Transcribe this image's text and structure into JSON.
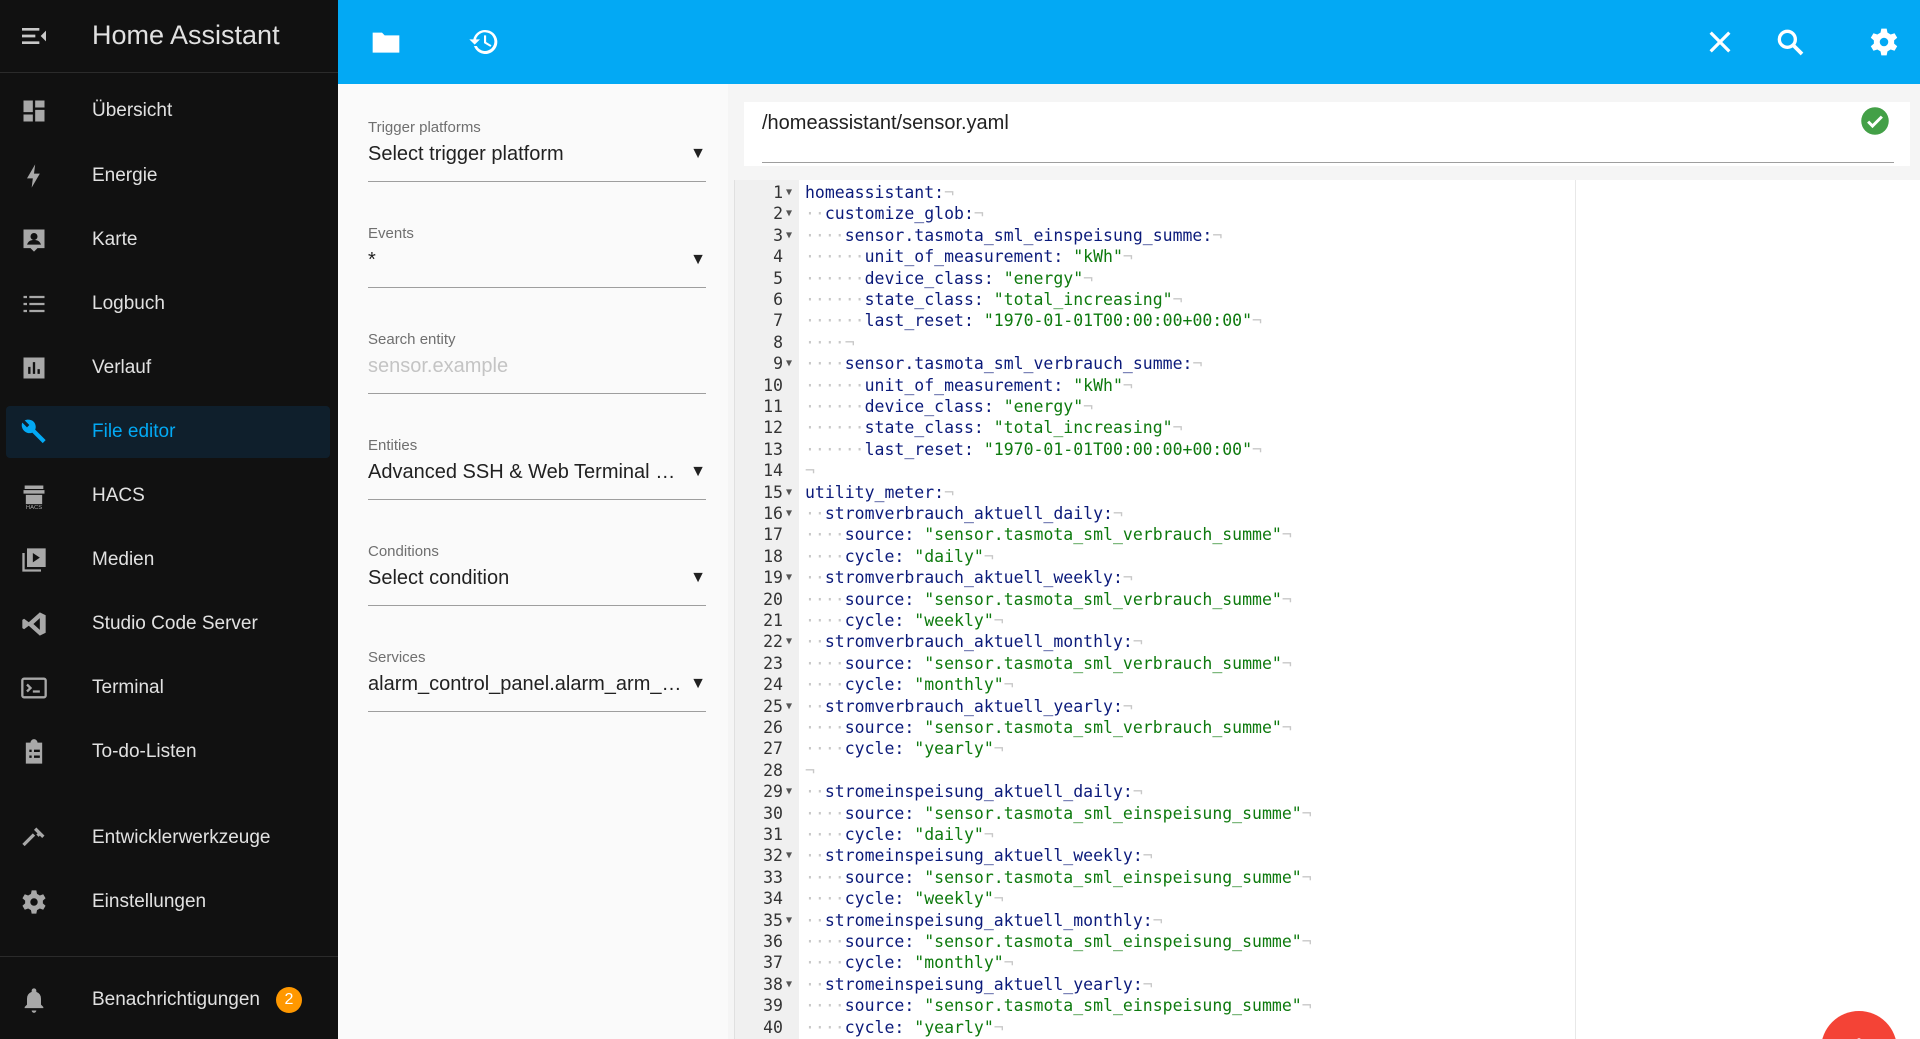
{
  "sidebar": {
    "title": "Home Assistant",
    "items": [
      {
        "id": "overview",
        "label": "Übersicht",
        "icon": "dashboard-icon"
      },
      {
        "id": "energy",
        "label": "Energie",
        "icon": "lightning-bolt-icon"
      },
      {
        "id": "map",
        "label": "Karte",
        "icon": "map-account-icon"
      },
      {
        "id": "logbook",
        "label": "Logbuch",
        "icon": "list-icon"
      },
      {
        "id": "history",
        "label": "Verlauf",
        "icon": "chart-box-icon"
      },
      {
        "id": "file-editor",
        "label": "File editor",
        "icon": "wrench-icon",
        "active": true
      },
      {
        "id": "hacs",
        "label": "HACS",
        "icon": "hacs-icon"
      },
      {
        "id": "media",
        "label": "Medien",
        "icon": "play-box-icon"
      },
      {
        "id": "studio-code-server",
        "label": "Studio Code Server",
        "icon": "vscode-icon"
      },
      {
        "id": "terminal",
        "label": "Terminal",
        "icon": "terminal-icon"
      },
      {
        "id": "todo",
        "label": "To-do-Listen",
        "icon": "clipboard-list-icon"
      },
      {
        "id": "developer-tools",
        "label": "Entwicklerwerkzeuge",
        "icon": "hammer-icon"
      },
      {
        "id": "settings",
        "label": "Einstellungen",
        "icon": "gear-icon"
      }
    ],
    "notifications": {
      "label": "Benachrichtigungen",
      "count": "2",
      "icon": "bell-icon"
    }
  },
  "topbar": {
    "icons": [
      "folder-icon",
      "history-icon",
      "close-icon",
      "search-icon",
      "gear-icon"
    ]
  },
  "form": {
    "trigger_platforms": {
      "label": "Trigger platforms",
      "value": "Select trigger platform"
    },
    "events": {
      "label": "Events",
      "value": "*"
    },
    "search_entity": {
      "label": "Search entity",
      "placeholder": "sensor.example"
    },
    "entities": {
      "label": "Entities",
      "value": "Advanced SSH & Web Terminal Up..."
    },
    "conditions": {
      "label": "Conditions",
      "value": "Select condition"
    },
    "services": {
      "label": "Services",
      "value": "alarm_control_panel.alarm_arm_a..."
    }
  },
  "editor": {
    "file_path": "/homeassistant/sensor.yaml",
    "status_icon": "check-circle-icon",
    "status_color": "#43a047",
    "lines": [
      {
        "n": "1",
        "fold": true,
        "indent": 0,
        "key": "homeassistant:",
        "val": ""
      },
      {
        "n": "2",
        "fold": true,
        "indent": 1,
        "key": "customize_glob:",
        "val": ""
      },
      {
        "n": "3",
        "fold": true,
        "indent": 2,
        "key": "sensor.tasmota_sml_einspeisung_summe:",
        "val": ""
      },
      {
        "n": "4",
        "fold": false,
        "indent": 3,
        "key": "unit_of_measurement: ",
        "val": "\"kWh\""
      },
      {
        "n": "5",
        "fold": false,
        "indent": 3,
        "key": "device_class: ",
        "val": "\"energy\""
      },
      {
        "n": "6",
        "fold": false,
        "indent": 3,
        "key": "state_class: ",
        "val": "\"total_increasing\""
      },
      {
        "n": "7",
        "fold": false,
        "indent": 3,
        "key": "last_reset: ",
        "val": "\"1970-01-01T00:00:00+00:00\""
      },
      {
        "n": "8",
        "fold": false,
        "indent": 2,
        "key": "",
        "val": ""
      },
      {
        "n": "9",
        "fold": true,
        "indent": 2,
        "key": "sensor.tasmota_sml_verbrauch_summe:",
        "val": ""
      },
      {
        "n": "10",
        "fold": false,
        "indent": 3,
        "key": "unit_of_measurement: ",
        "val": "\"kWh\""
      },
      {
        "n": "11",
        "fold": false,
        "indent": 3,
        "key": "device_class: ",
        "val": "\"energy\""
      },
      {
        "n": "12",
        "fold": false,
        "indent": 3,
        "key": "state_class: ",
        "val": "\"total_increasing\""
      },
      {
        "n": "13",
        "fold": false,
        "indent": 3,
        "key": "last_reset: ",
        "val": "\"1970-01-01T00:00:00+00:00\""
      },
      {
        "n": "14",
        "fold": false,
        "indent": 0,
        "key": "",
        "val": ""
      },
      {
        "n": "15",
        "fold": true,
        "indent": 0,
        "key": "utility_meter:",
        "val": ""
      },
      {
        "n": "16",
        "fold": true,
        "indent": 1,
        "key": "stromverbrauch_aktuell_daily:",
        "val": ""
      },
      {
        "n": "17",
        "fold": false,
        "indent": 2,
        "key": "source: ",
        "val": "\"sensor.tasmota_sml_verbrauch_summe\""
      },
      {
        "n": "18",
        "fold": false,
        "indent": 2,
        "key": "cycle: ",
        "val": "\"daily\""
      },
      {
        "n": "19",
        "fold": true,
        "indent": 1,
        "key": "stromverbrauch_aktuell_weekly:",
        "val": ""
      },
      {
        "n": "20",
        "fold": false,
        "indent": 2,
        "key": "source: ",
        "val": "\"sensor.tasmota_sml_verbrauch_summe\""
      },
      {
        "n": "21",
        "fold": false,
        "indent": 2,
        "key": "cycle: ",
        "val": "\"weekly\""
      },
      {
        "n": "22",
        "fold": true,
        "indent": 1,
        "key": "stromverbrauch_aktuell_monthly:",
        "val": ""
      },
      {
        "n": "23",
        "fold": false,
        "indent": 2,
        "key": "source: ",
        "val": "\"sensor.tasmota_sml_verbrauch_summe\""
      },
      {
        "n": "24",
        "fold": false,
        "indent": 2,
        "key": "cycle: ",
        "val": "\"monthly\""
      },
      {
        "n": "25",
        "fold": true,
        "indent": 1,
        "key": "stromverbrauch_aktuell_yearly:",
        "val": ""
      },
      {
        "n": "26",
        "fold": false,
        "indent": 2,
        "key": "source: ",
        "val": "\"sensor.tasmota_sml_verbrauch_summe\""
      },
      {
        "n": "27",
        "fold": false,
        "indent": 2,
        "key": "cycle: ",
        "val": "\"yearly\""
      },
      {
        "n": "28",
        "fold": false,
        "indent": 0,
        "key": "",
        "val": ""
      },
      {
        "n": "29",
        "fold": true,
        "indent": 1,
        "key": "stromeinspeisung_aktuell_daily:",
        "val": ""
      },
      {
        "n": "30",
        "fold": false,
        "indent": 2,
        "key": "source: ",
        "val": "\"sensor.tasmota_sml_einspeisung_summe\""
      },
      {
        "n": "31",
        "fold": false,
        "indent": 2,
        "key": "cycle: ",
        "val": "\"daily\""
      },
      {
        "n": "32",
        "fold": true,
        "indent": 1,
        "key": "stromeinspeisung_aktuell_weekly:",
        "val": ""
      },
      {
        "n": "33",
        "fold": false,
        "indent": 2,
        "key": "source: ",
        "val": "\"sensor.tasmota_sml_einspeisung_summe\""
      },
      {
        "n": "34",
        "fold": false,
        "indent": 2,
        "key": "cycle: ",
        "val": "\"weekly\""
      },
      {
        "n": "35",
        "fold": true,
        "indent": 1,
        "key": "stromeinspeisung_aktuell_monthly:",
        "val": ""
      },
      {
        "n": "36",
        "fold": false,
        "indent": 2,
        "key": "source: ",
        "val": "\"sensor.tasmota_sml_einspeisung_summe\""
      },
      {
        "n": "37",
        "fold": false,
        "indent": 2,
        "key": "cycle: ",
        "val": "\"monthly\""
      },
      {
        "n": "38",
        "fold": true,
        "indent": 1,
        "key": "stromeinspeisung_aktuell_yearly:",
        "val": ""
      },
      {
        "n": "39",
        "fold": false,
        "indent": 2,
        "key": "source: ",
        "val": "\"sensor.tasmota_sml_einspeisung_summe\""
      },
      {
        "n": "40",
        "fold": false,
        "indent": 2,
        "key": "cycle: ",
        "val": "\"yearly\""
      }
    ]
  },
  "fab": {
    "icon": "add-icon",
    "color": "#f44336"
  },
  "colors": {
    "accent": "#03a9f4",
    "sidebar_bg": "#111111",
    "badge": "#ff9800"
  }
}
